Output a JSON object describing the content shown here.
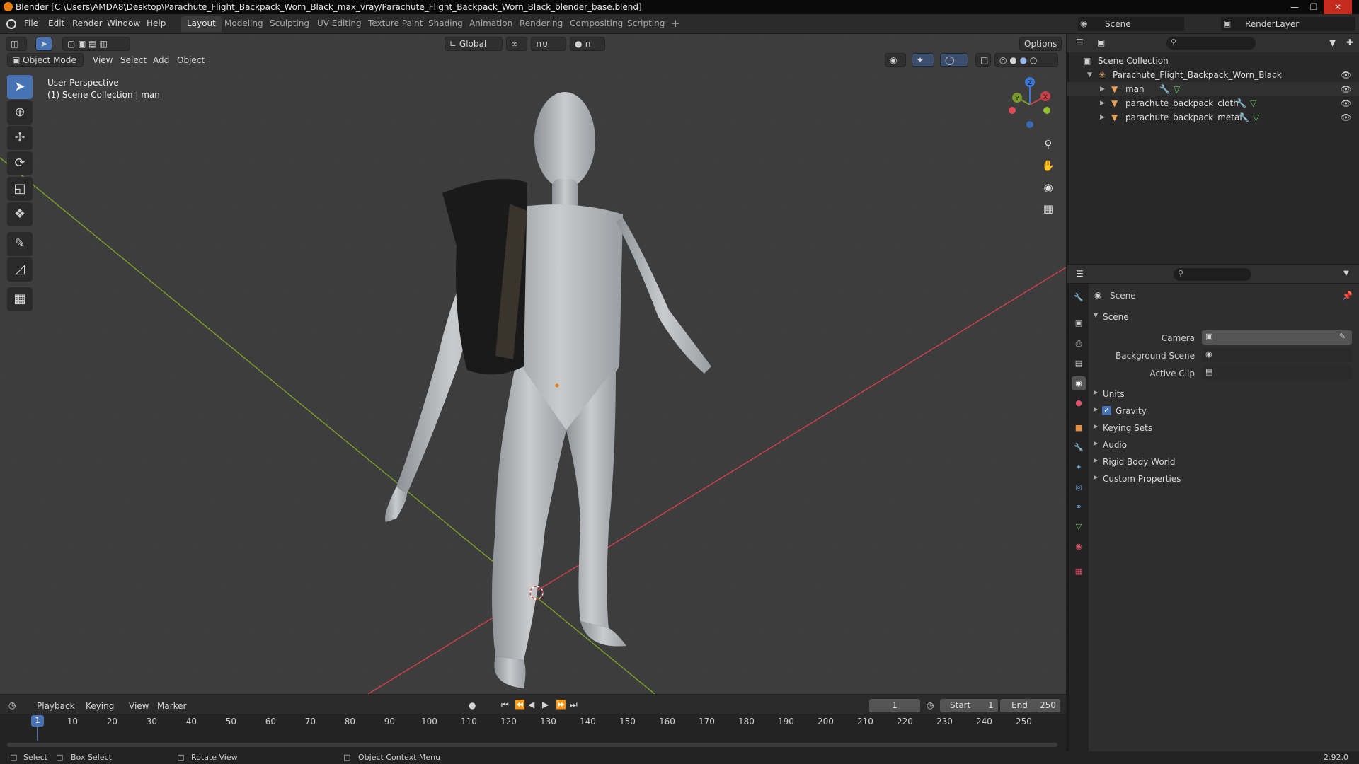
{
  "window": {
    "title": "Blender [C:\\Users\\AMDA8\\Desktop\\Parachute_Flight_Backpack_Worn_Black_max_vray/Parachute_Flight_Backpack_Worn_Black_blender_base.blend]"
  },
  "menubar": {
    "items": [
      "File",
      "Edit",
      "Render",
      "Window",
      "Help"
    ]
  },
  "workspaces": [
    "Layout",
    "Modeling",
    "Sculpting",
    "UV Editing",
    "Texture Paint",
    "Shading",
    "Animation",
    "Rendering",
    "Compositing",
    "Scripting"
  ],
  "workspace_add": "+",
  "scene_selector": {
    "label": "Scene"
  },
  "renderlayer_selector": {
    "label": "RenderLayer"
  },
  "viewport": {
    "mode": "Object Mode",
    "menus": [
      "View",
      "Select",
      "Add",
      "Object"
    ],
    "orientation": "Global",
    "options_label": "Options",
    "overlay_line1": "User Perspective",
    "overlay_line2": "(1) Scene Collection | man",
    "gizmo": {
      "x": "X",
      "y": "Y",
      "z": "Z"
    }
  },
  "toolbar": [
    "select-box",
    "cursor",
    "move",
    "rotate",
    "scale",
    "transform",
    "annotate",
    "measure",
    "add-cube"
  ],
  "outliner": {
    "root": "Scene Collection",
    "collection": "Parachute_Flight_Backpack_Worn_Black",
    "objects": [
      "man",
      "parachute_backpack_cloth",
      "parachute_backpack_metal"
    ]
  },
  "properties": {
    "context": "Scene",
    "panel_title": "Scene",
    "camera_label": "Camera",
    "background_scene_label": "Background Scene",
    "active_clip_label": "Active Clip",
    "panels": [
      "Units",
      "Gravity",
      "Keying Sets",
      "Audio",
      "Rigid Body World",
      "Custom Properties"
    ],
    "gravity_checked": true
  },
  "timeline": {
    "menus": [
      "Playback",
      "Keying",
      "View",
      "Marker"
    ],
    "current_frame": "1",
    "start_label": "Start",
    "start_value": "1",
    "end_label": "End",
    "end_value": "250",
    "ruler": [
      "1",
      "10",
      "20",
      "30",
      "40",
      "50",
      "60",
      "70",
      "80",
      "90",
      "100",
      "110",
      "120",
      "130",
      "140",
      "150",
      "160",
      "170",
      "180",
      "190",
      "200",
      "210",
      "220",
      "230",
      "240",
      "250"
    ]
  },
  "statusbar": {
    "select": "Select",
    "box_select": "Box Select",
    "rotate_view": "Rotate View",
    "context_menu": "Object Context Menu",
    "version": "2.92.0"
  },
  "colors": {
    "accent": "#4772b3",
    "x_axis": "#c8404a",
    "y_axis": "#7a9a2a",
    "z_axis": "#3a78d8",
    "active_tab": "#3c3c3c"
  }
}
